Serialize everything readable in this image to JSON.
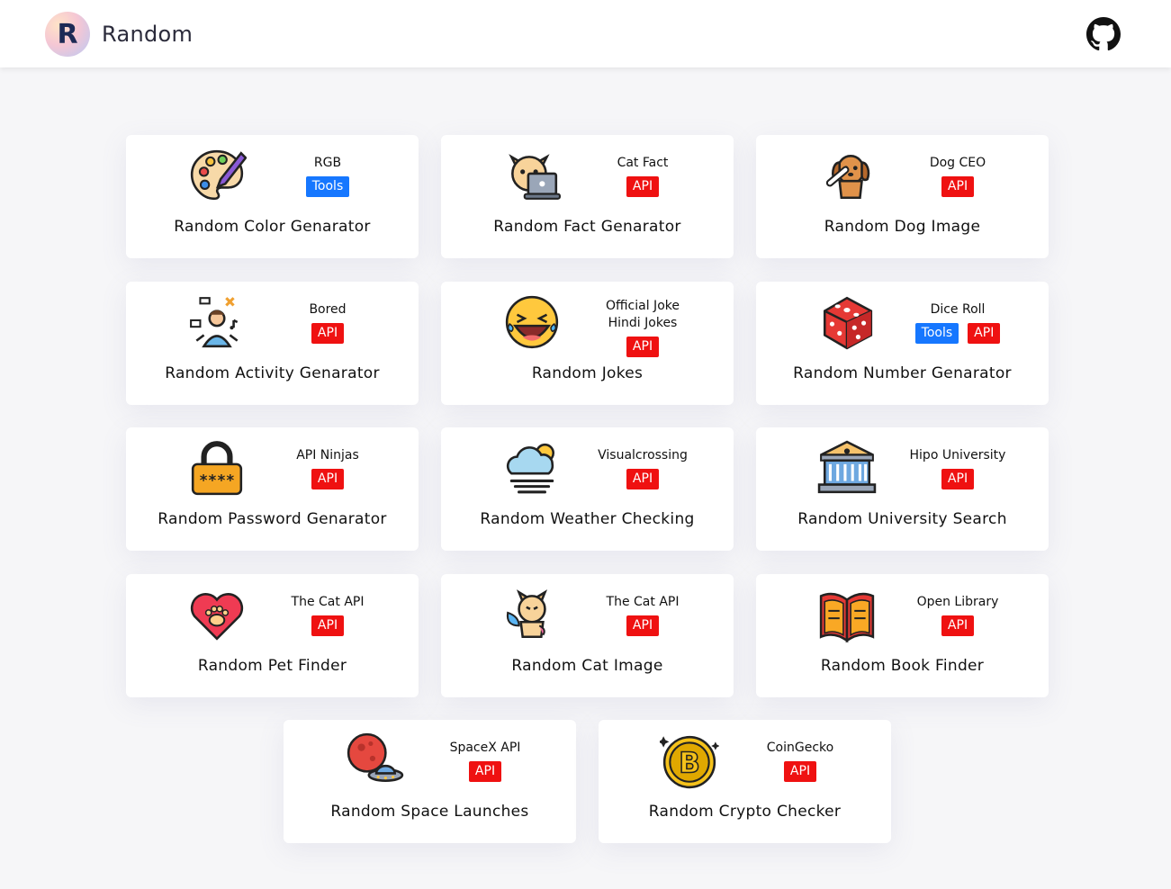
{
  "header": {
    "logo_letter": "R",
    "brand": "Random",
    "github_icon": "github-icon"
  },
  "cards": [
    {
      "title": "Random Color Genarator",
      "source": [
        "RGB"
      ],
      "badges": [
        {
          "label": "Tools",
          "kind": "tools"
        }
      ],
      "icon": "palette-icon"
    },
    {
      "title": "Random Fact Genarator",
      "source": [
        "Cat Fact"
      ],
      "badges": [
        {
          "label": "API",
          "kind": "api"
        }
      ],
      "icon": "cat-laptop-icon"
    },
    {
      "title": "Random Dog Image",
      "source": [
        "Dog CEO"
      ],
      "badges": [
        {
          "label": "API",
          "kind": "api"
        }
      ],
      "icon": "dog-bone-icon"
    },
    {
      "title": "Random Activity Genarator",
      "source": [
        "Bored"
      ],
      "badges": [
        {
          "label": "API",
          "kind": "api"
        }
      ],
      "icon": "activity-person-icon"
    },
    {
      "title": "Random Jokes",
      "source": [
        "Official Joke",
        "Hindi Jokes"
      ],
      "badges": [
        {
          "label": "API",
          "kind": "api"
        }
      ],
      "icon": "laughing-emoji-icon"
    },
    {
      "title": "Random Number Genarator",
      "source": [
        "Dice Roll"
      ],
      "badges": [
        {
          "label": "Tools",
          "kind": "tools"
        },
        {
          "label": "API",
          "kind": "api"
        }
      ],
      "icon": "dice-icon"
    },
    {
      "title": "Random Password Genarator",
      "source": [
        "API Ninjas"
      ],
      "badges": [
        {
          "label": "API",
          "kind": "api"
        }
      ],
      "icon": "padlock-password-icon"
    },
    {
      "title": "Random Weather Checking",
      "source": [
        "Visualcrossing"
      ],
      "badges": [
        {
          "label": "API",
          "kind": "api"
        }
      ],
      "icon": "weather-cloud-sun-icon"
    },
    {
      "title": "Random University Search",
      "source": [
        "Hipo University"
      ],
      "badges": [
        {
          "label": "API",
          "kind": "api"
        }
      ],
      "icon": "university-building-icon"
    },
    {
      "title": "Random Pet Finder",
      "source": [
        "The Cat API"
      ],
      "badges": [
        {
          "label": "API",
          "kind": "api"
        }
      ],
      "icon": "heart-paw-icon"
    },
    {
      "title": "Random Cat Image",
      "source": [
        "The Cat API"
      ],
      "badges": [
        {
          "label": "API",
          "kind": "api"
        }
      ],
      "icon": "cat-butterfly-icon"
    },
    {
      "title": "Random Book Finder",
      "source": [
        "Open Library"
      ],
      "badges": [
        {
          "label": "API",
          "kind": "api"
        }
      ],
      "icon": "open-book-icon"
    },
    {
      "title": "Random Space Launches",
      "source": [
        "SpaceX API"
      ],
      "badges": [
        {
          "label": "API",
          "kind": "api"
        }
      ],
      "icon": "planet-ufo-icon"
    },
    {
      "title": "Random Crypto Checker",
      "source": [
        "CoinGecko"
      ],
      "badges": [
        {
          "label": "API",
          "kind": "api"
        }
      ],
      "icon": "bitcoin-icon"
    }
  ]
}
